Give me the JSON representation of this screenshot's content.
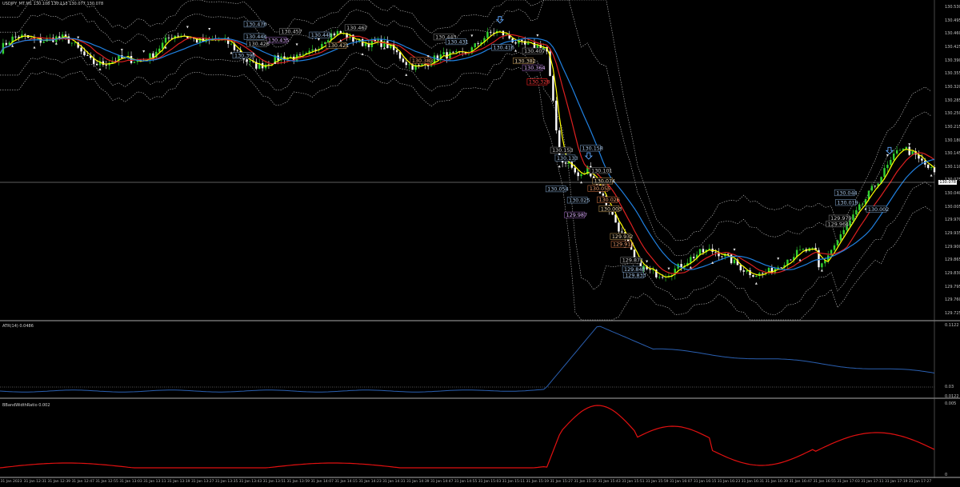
{
  "main_panel": {
    "title": "USDJPY_MT,M1 130.108 130.113 130.077 130.078",
    "current_price": "130.078",
    "price_axis": [
      "130.530",
      "130.495",
      "130.460",
      "130.425",
      "130.390",
      "130.355",
      "130.320",
      "130.285",
      "130.250",
      "130.215",
      "130.180",
      "130.145",
      "130.110",
      "130.075",
      "130.040",
      "130.005",
      "129.970",
      "129.935",
      "129.900",
      "129.865",
      "129.830",
      "129.795",
      "129.760",
      "129.725"
    ]
  },
  "atr_panel": {
    "title": "ATR(14) 0.0486",
    "axis": [
      "0.1122",
      "0.03",
      "0.0122"
    ]
  },
  "bband_panel": {
    "title": "BBandWidthRatio 0.002",
    "axis": [
      "0.005",
      "0"
    ]
  },
  "time_axis": [
    "31 Jan 2023",
    "31 Jan 12:31",
    "31 Jan 12:39",
    "31 Jan 12:47",
    "31 Jan 12:55",
    "31 Jan 13:03",
    "31 Jan 13:11",
    "31 Jan 13:19",
    "31 Jan 13:27",
    "31 Jan 13:35",
    "31 Jan 13:43",
    "31 Jan 13:51",
    "31 Jan 13:59",
    "31 Jan 14:07",
    "31 Jan 14:15",
    "31 Jan 14:23",
    "31 Jan 14:31",
    "31 Jan 14:39",
    "31 Jan 14:47",
    "31 Jan 14:55",
    "31 Jan 15:03",
    "31 Jan 15:11",
    "31 Jan 15:19",
    "31 Jan 15:27",
    "31 Jan 15:35",
    "31 Jan 15:43",
    "31 Jan 15:51",
    "31 Jan 15:59",
    "31 Jan 16:07",
    "31 Jan 16:15",
    "31 Jan 16:23",
    "31 Jan 16:31",
    "31 Jan 16:39",
    "31 Jan 16:47",
    "31 Jan 16:55",
    "31 Jan 17:03",
    "31 Jan 17:11",
    "31 Jan 17:19",
    "31 Jan 17:27"
  ],
  "annotations": [
    {
      "text": "130.476",
      "v": 130.476,
      "t": 0.262,
      "color": "#a9c7e8",
      "border": "#6e8fb3"
    },
    {
      "text": "130.444",
      "v": 130.444,
      "t": 0.262,
      "color": "#a9c7e8",
      "border": "#6e8fb3"
    },
    {
      "text": "130.457",
      "v": 130.457,
      "t": 0.3,
      "color": "#c8c8c8",
      "border": "#777"
    },
    {
      "text": "130.435",
      "v": 130.435,
      "t": 0.286,
      "color": "#e0b4ff",
      "border": "#8a5aa8"
    },
    {
      "text": "130.426",
      "v": 130.426,
      "t": 0.265,
      "color": "#c8c8c8",
      "border": "#777"
    },
    {
      "text": "130.448",
      "v": 130.448,
      "t": 0.332,
      "color": "#a9c7e8",
      "border": "#6e8fb3"
    },
    {
      "text": "130.421",
      "v": 130.421,
      "t": 0.35,
      "color": "#f0d8b0",
      "border": "#b08a4a"
    },
    {
      "text": "130.467",
      "v": 130.467,
      "t": 0.37,
      "color": "#c8c8c8",
      "border": "#777"
    },
    {
      "text": "130.396",
      "v": 130.396,
      "t": 0.25,
      "color": "#a9c7e8",
      "border": "#6e8fb3"
    },
    {
      "text": "130.443",
      "v": 130.443,
      "t": 0.465,
      "color": "#c8c8c8",
      "border": "#777"
    },
    {
      "text": "130.431",
      "v": 130.431,
      "t": 0.478,
      "color": "#a9c7e8",
      "border": "#6e8fb3"
    },
    {
      "text": "130.383",
      "v": 130.383,
      "t": 0.44,
      "color": "#f4a070",
      "border": "#c0683a"
    },
    {
      "text": "130.416",
      "v": 130.416,
      "t": 0.527,
      "color": "#a9c7e8",
      "border": "#6e8fb3"
    },
    {
      "text": "130.407",
      "v": 130.407,
      "t": 0.56,
      "color": "#c8c8c8",
      "border": "#777"
    },
    {
      "text": "130.382",
      "v": 130.382,
      "t": 0.55,
      "color": "#f0d8b0",
      "border": "#b08a4a"
    },
    {
      "text": "130.364",
      "v": 130.364,
      "t": 0.56,
      "color": "#e0b4ff",
      "border": "#8a5aa8"
    },
    {
      "text": "130.328",
      "v": 130.328,
      "t": 0.565,
      "color": "#ff4040",
      "border": "#ff2020"
    },
    {
      "text": "130.153",
      "v": 130.153,
      "t": 0.59,
      "color": "#c8c8c8",
      "border": "#777"
    },
    {
      "text": "130.158",
      "v": 130.158,
      "t": 0.622,
      "color": "#a9c7e8",
      "border": "#6e8fb3"
    },
    {
      "text": "130.133",
      "v": 130.133,
      "t": 0.595,
      "color": "#a9c7e8",
      "border": "#6e8fb3"
    },
    {
      "text": "130.101",
      "v": 130.101,
      "t": 0.632,
      "color": "#c8c8c8",
      "border": "#777"
    },
    {
      "text": "130.074",
      "v": 130.074,
      "t": 0.635,
      "color": "#f0d8b0",
      "border": "#b08a4a"
    },
    {
      "text": "130.055",
      "v": 130.055,
      "t": 0.63,
      "color": "#f4a070",
      "border": "#c0683a"
    },
    {
      "text": "130.054",
      "v": 130.054,
      "t": 0.585,
      "color": "#a9c7e8",
      "border": "#6e8fb3"
    },
    {
      "text": "130.025",
      "v": 130.025,
      "t": 0.608,
      "color": "#a9c7e8",
      "border": "#6e8fb3"
    },
    {
      "text": "130.026",
      "v": 130.026,
      "t": 0.64,
      "color": "#f4a070",
      "border": "#c0683a"
    },
    {
      "text": "130.003",
      "v": 130.003,
      "t": 0.642,
      "color": "#f0d8b0",
      "border": "#b08a4a"
    },
    {
      "text": "129.987",
      "v": 129.987,
      "t": 0.605,
      "color": "#e0b4ff",
      "border": "#8a5aa8"
    },
    {
      "text": "129.932",
      "v": 129.932,
      "t": 0.654,
      "color": "#f0d8b0",
      "border": "#b08a4a"
    },
    {
      "text": "129.912",
      "v": 129.912,
      "t": 0.655,
      "color": "#f4a070",
      "border": "#c0683a"
    },
    {
      "text": "129.871",
      "v": 129.871,
      "t": 0.665,
      "color": "#c8c8c8",
      "border": "#777"
    },
    {
      "text": "129.848",
      "v": 129.848,
      "t": 0.667,
      "color": "#a9c7e8",
      "border": "#6e8fb3"
    },
    {
      "text": "129.833",
      "v": 129.833,
      "t": 0.668,
      "color": "#a9c7e8",
      "border": "#6e8fb3"
    },
    {
      "text": "130.044",
      "v": 130.044,
      "t": 0.894,
      "color": "#a9c7e8",
      "border": "#6e8fb3"
    },
    {
      "text": "130.019",
      "v": 130.019,
      "t": 0.895,
      "color": "#a9c7e8",
      "border": "#6e8fb3"
    },
    {
      "text": "130.002",
      "v": 130.002,
      "t": 0.928,
      "color": "#a9c7e8",
      "border": "#6e8fb3"
    },
    {
      "text": "129.979",
      "v": 129.979,
      "t": 0.888,
      "color": "#c8c8c8",
      "border": "#777"
    },
    {
      "text": "129.964",
      "v": 129.964,
      "t": 0.885,
      "color": "#c8c8c8",
      "border": "#777"
    }
  ],
  "colors": {
    "background": "#000000",
    "candle_bull": "#32d232",
    "candle_bear": "#ffffff",
    "ma_fast": "#ffff00",
    "ma_mid": "#dd2020",
    "ma_slow": "#2080e0",
    "bands": "#c0c0c0",
    "atr": "#2a5fb0",
    "bbw": "#e01010"
  }
}
